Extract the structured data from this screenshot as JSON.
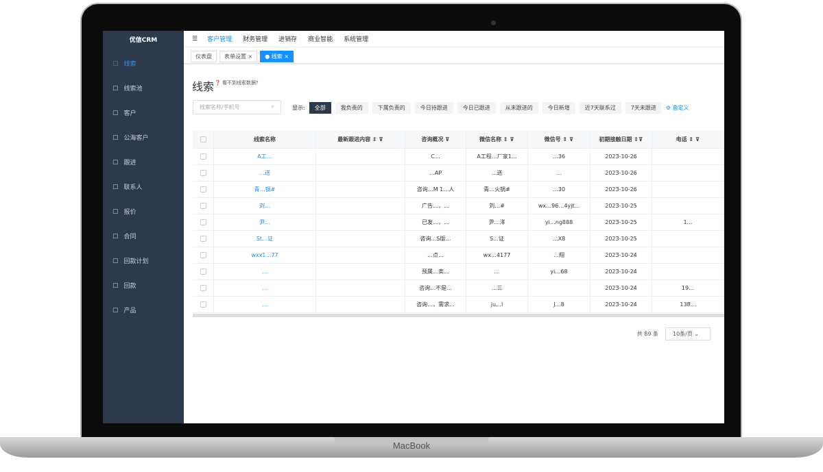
{
  "device_label": "MacBook",
  "app": {
    "logo": "优信CRM"
  },
  "sidebar": {
    "items": [
      {
        "label": "线索",
        "icon": "edit-icon",
        "active": true
      },
      {
        "label": "线索池",
        "icon": "pool-icon"
      },
      {
        "label": "客户",
        "icon": "customer-icon"
      },
      {
        "label": "公海客户",
        "icon": "user-icon"
      },
      {
        "label": "跟进",
        "icon": "followup-icon"
      },
      {
        "label": "联系人",
        "icon": "contacts-icon"
      },
      {
        "label": "报价",
        "icon": "quote-icon"
      },
      {
        "label": "合同",
        "icon": "contract-icon"
      },
      {
        "label": "回款计划",
        "icon": "plan-icon"
      },
      {
        "label": "回款",
        "icon": "payment-icon"
      },
      {
        "label": "产品",
        "icon": "product-icon"
      }
    ]
  },
  "topnav": {
    "items": [
      "客户管理",
      "财务管理",
      "进销存",
      "商业智能",
      "系统管理"
    ],
    "active": "客户管理"
  },
  "tabs": [
    {
      "label": "仪表盘"
    },
    {
      "label": "表单设置 ×"
    },
    {
      "label": "● 线索 ×",
      "active": true
    }
  ],
  "page": {
    "title": "线索",
    "hint": "看不到线索数据?",
    "search_placeholder": "线索名称/手机号",
    "filter_label": "显示:",
    "filters": [
      "全部",
      "我负责的",
      "下属负责的",
      "今日待跟进",
      "今日已跟进",
      "从未跟进的",
      "今日新增",
      "近7天联系过",
      "7天未跟进"
    ],
    "active_filter": "全部",
    "customize": "⚙ 自定义"
  },
  "table": {
    "columns": [
      "",
      "线索名称",
      "最新跟进内容 ⇕ ⊽",
      "咨询概况 ⊽",
      "微信名称 ⇕ ⊽",
      "微信号 ⇕ ⊽",
      "初期接触日期 ⇕⊽",
      "电话 ⇕ ⊽"
    ],
    "rows": [
      [
        "A工…",
        "",
        "C…",
        "A工程…厂家1...",
        "…36",
        "2023-10-26",
        ""
      ],
      [
        "…送",
        "",
        "…AP",
        "…送",
        "…",
        "2023-10-26",
        ""
      ],
      [
        "青…锅#",
        "",
        "咨询…M 1…人",
        "青…火锅#",
        "…30",
        "2023-10-26",
        ""
      ],
      [
        "刘…",
        "",
        "广告…，…",
        "刘…#",
        "wx…96…4yjt...",
        "2023-10-25",
        ""
      ],
      [
        "尹…",
        "",
        "已发…，…",
        "尹…洋",
        "yi…ng888",
        "2023-10-25",
        "1…"
      ],
      [
        "St…证",
        "",
        "咨询…S版…",
        "S…证",
        "…X8",
        "2023-10-25",
        ""
      ],
      [
        "wxx1…77",
        "",
        "…点…",
        "wx…4177",
        "…翔",
        "2023-10-24",
        ""
      ],
      [
        "…",
        "",
        "预属…卖…",
        "…",
        "yi…68",
        "2023-10-24",
        ""
      ],
      [
        "…",
        "",
        "咨询…不是...",
        "…三",
        "",
        "2023-10-24",
        "19…"
      ],
      [
        "…",
        "",
        "咨询…，需求...",
        "ju…l",
        "J…8",
        "2023-10-24",
        "138…"
      ]
    ]
  },
  "pagination": {
    "total": "共 89 条",
    "page_size": "10条/页 ⌄"
  }
}
